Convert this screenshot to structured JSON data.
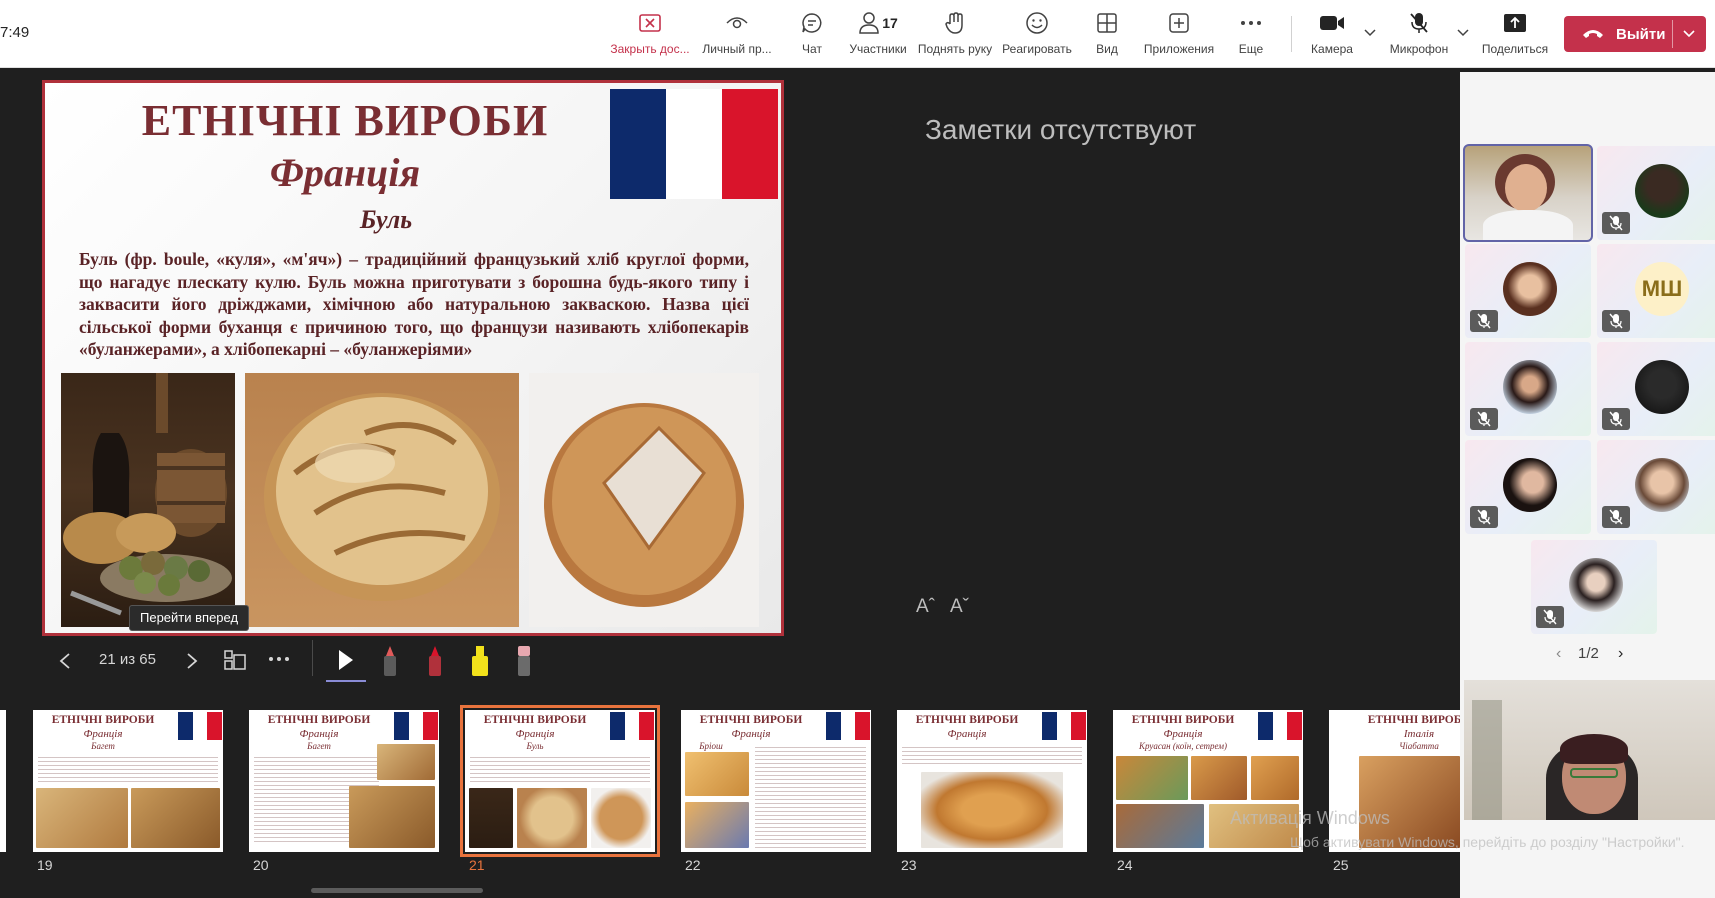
{
  "clock": "7:49",
  "toolbar": {
    "close_share": "Закрыть дос...",
    "private_view": "Личный пр...",
    "chat": "Чат",
    "participants": "Участники",
    "participants_count": "17",
    "raise_hand": "Поднять руку",
    "react": "Реагировать",
    "view": "Вид",
    "apps": "Приложения",
    "more": "Еще",
    "camera": "Камера",
    "mic": "Микрофон",
    "share": "Поделиться",
    "leave": "Выйти"
  },
  "slide": {
    "title": "ЕТНІЧНІ ВИРОБИ",
    "subtitle": "Франція",
    "heading": "Буль",
    "body": "Буль (фр. boule, «куля», «м'яч») – традиційний французький хліб круглої форми, що нагадує плескату кулю. Буль можна приготувати з борошна будь-якого типу і заквасити його дріжджами, хімічною або натуральною закваскою. Назва цієї сільської форми буханця є причиною того, що французи називають хлібопекарів «буланжерами», а хлібопекарні – «буланжеріями»",
    "images": [
      "still-life-painting",
      "boule-bread",
      "round-loaf"
    ]
  },
  "tooltip": "Перейти вперед",
  "slide_counter": "21 из 65",
  "notes": "Заметки отсутствуют",
  "font_increase": "Aˆ",
  "font_decrease": "Aˇ",
  "filmstrip": [
    {
      "num": "19",
      "title": "ЕТНІЧНІ ВИРОБИ",
      "country": "Франція",
      "item": "Багет"
    },
    {
      "num": "20",
      "title": "ЕТНІЧНІ ВИРОБИ",
      "country": "Франція",
      "item": "Багет"
    },
    {
      "num": "21",
      "title": "ЕТНІЧНІ ВИРОБИ",
      "country": "Франція",
      "item": "Буль"
    },
    {
      "num": "22",
      "title": "ЕТНІЧНІ ВИРОБИ",
      "country": "Франція",
      "item": "Бріош"
    },
    {
      "num": "23",
      "title": "ЕТНІЧНІ ВИРОБИ",
      "country": "Франція",
      "item": ""
    },
    {
      "num": "24",
      "title": "ЕТНІЧНІ ВИРОБИ",
      "country": "Франція",
      "item": "Круасан (коїн, сетрем)"
    },
    {
      "num": "25",
      "title": "ЕТНІЧНІ ВИРОБИ",
      "country": "Італія",
      "item": "Чіабатта"
    }
  ],
  "participants_grid": {
    "initials": "МШ",
    "pager": "1/2"
  },
  "watermark": {
    "line1": "Активація Windows",
    "line2": "Щоб активувати Windows, перейдіть до розділу \"Настройки\"."
  },
  "colors": {
    "accent_red": "#c4314b",
    "slide_border": "#b0313b",
    "slide_text": "#7a2e33",
    "flag_blue": "#0d2a6b",
    "flag_red": "#d9142b",
    "active_thumb": "#e8733d",
    "speaker_outline": "#6264a7"
  }
}
